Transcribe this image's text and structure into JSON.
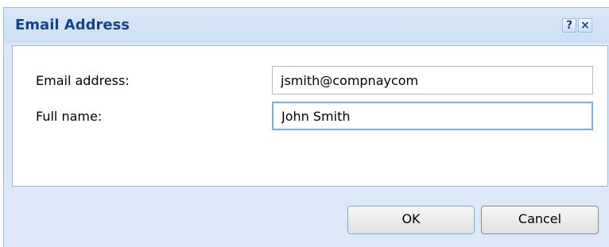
{
  "dialog": {
    "title": "Email Address",
    "help_glyph": "?",
    "close_glyph": "×"
  },
  "form": {
    "email_label": "Email address:",
    "email_value": "jsmith@compnaycom",
    "name_label": "Full name:",
    "name_value": "John Smith"
  },
  "buttons": {
    "ok_label": "OK",
    "cancel_label": "Cancel"
  },
  "icons": {
    "help": "help-icon",
    "close": "close-icon"
  },
  "colors": {
    "title_text": "#15428b",
    "frame_bg": "#dfe8f6",
    "border": "#99bbe8",
    "focus_border": "#7eadd9"
  }
}
